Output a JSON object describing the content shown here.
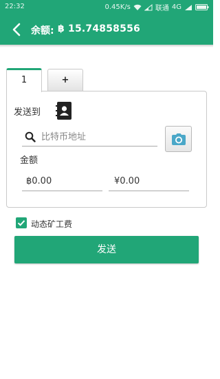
{
  "status_bar": {
    "time": "22:32",
    "speed": "0.45K/s",
    "carrier": "联通",
    "network": "4G"
  },
  "header": {
    "balance_label": "余额:",
    "balance_value": "฿ 15.74858556"
  },
  "tabs": [
    {
      "label": "1",
      "selected": true
    },
    {
      "label": "+",
      "selected": false
    }
  ],
  "form": {
    "send_to_label": "发送到",
    "address_placeholder": "比特币地址",
    "amount_label": "金额",
    "btc_amount": "฿0.00",
    "cny_amount": "¥0.00"
  },
  "fee": {
    "label": "动态矿工费",
    "checked": true
  },
  "send_button_label": "发送",
  "colors": {
    "primary": "#21a677"
  }
}
